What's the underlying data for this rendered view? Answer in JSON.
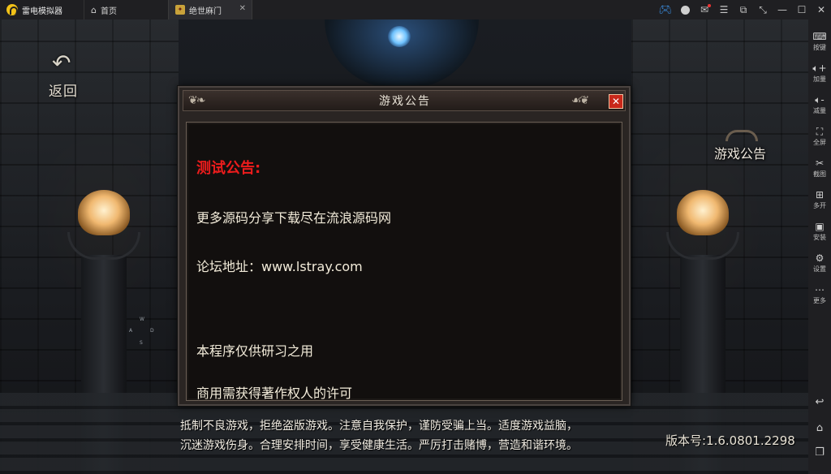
{
  "app": {
    "name": "雷电模拟器"
  },
  "tabs": [
    {
      "label": "首页",
      "icon": "home-icon"
    },
    {
      "label": "绝世麻门",
      "icon": "game-app-icon",
      "active": true
    }
  ],
  "window_controls": [
    "gamepad-icon",
    "account-icon",
    "mail-icon",
    "menu-icon",
    "restore-window-icon",
    "fullscreen-toggle-icon",
    "minimize-icon",
    "maximize-icon",
    "close-icon"
  ],
  "sidebar": {
    "items": [
      {
        "label": "按键",
        "icon": "keyboard-icon"
      },
      {
        "label": "加量",
        "icon": "volume-up-icon"
      },
      {
        "label": "减量",
        "icon": "volume-down-icon"
      },
      {
        "label": "全屏",
        "icon": "fullscreen-icon"
      },
      {
        "label": "截图",
        "icon": "scissors-icon"
      },
      {
        "label": "多开",
        "icon": "multi-instance-icon"
      },
      {
        "label": "安装",
        "icon": "apk-install-icon"
      },
      {
        "label": "设置",
        "icon": "gear-icon"
      },
      {
        "label": "更多",
        "icon": "more-icon"
      }
    ],
    "nav": [
      "back-icon",
      "home-icon",
      "recent-apps-icon"
    ]
  },
  "game": {
    "back_label": "返回",
    "notice_button_label": "游戏公告",
    "key_hints": [
      "W",
      "A",
      "D",
      "S"
    ],
    "dialog": {
      "title": "游戏公告",
      "close_glyph": "✕",
      "lines": {
        "heading": "测试公告:",
        "line1": "更多源码分享下载尽在流浪源码网",
        "line2": "论坛地址：www.lstray.com",
        "line3": "本程序仅供研习之用",
        "line4": "商用需获得著作权人的许可"
      }
    },
    "footer": {
      "line1": "抵制不良游戏，拒绝盗版游戏。注意自我保护，谨防受骗上当。适度游戏益脑，",
      "line2": "沉迷游戏伤身。合理安排时间，享受健康生活。严厉打击赌博，营造和谐环境。"
    },
    "version": "版本号:1.6.0801.2298"
  }
}
